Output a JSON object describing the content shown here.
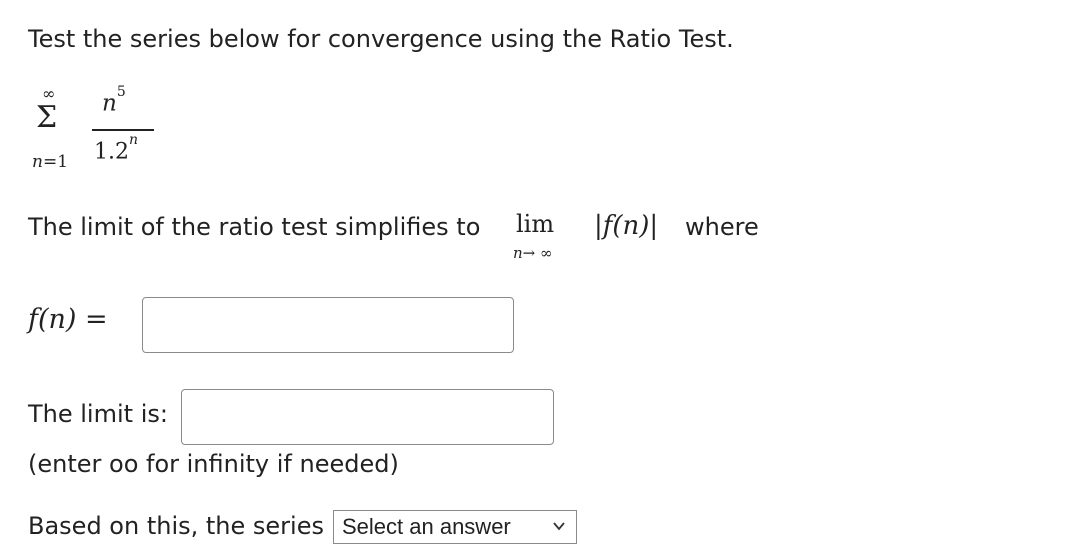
{
  "question": {
    "prompt": "Test the series below for convergence using the Ratio Test.",
    "series": {
      "upper": "∞",
      "sigma": "Σ",
      "lower_var": "n",
      "lower_eq": "=1",
      "numerator_base": "n",
      "numerator_exp": "5",
      "denominator_base": "1.2",
      "denominator_exp": "n"
    },
    "limit_text": "The limit of the ratio test simplifies to",
    "lim_word": "lim",
    "lim_sub_var": "n",
    "lim_sub_rest": "→ ∞",
    "abs_expr": "|f(n)|",
    "where_text": "where",
    "fn_label": "f(n)",
    "fn_eq": " =",
    "fn_input_value": "",
    "limit_label": "The limit is:",
    "limit_input_value": "",
    "hint": "(enter oo for infinity if needed)",
    "conclusion_text": "Based on this, the series",
    "select": {
      "selected": "Select an answer",
      "chevron_icon": "chevron-down-icon"
    }
  }
}
